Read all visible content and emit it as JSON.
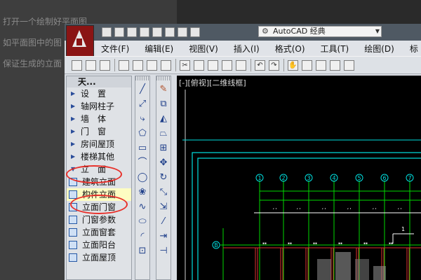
{
  "background": {
    "lines": [
      "打开一个绘制好平面图",
      "如平面图中的图",
      "保证生成的立面"
    ]
  },
  "toolbar": {
    "workspace": "AutoCAD 经典"
  },
  "menubar": {
    "items": [
      "文件(F)",
      "编辑(E)",
      "视图(V)",
      "插入(I)",
      "格式(O)",
      "工具(T)",
      "绘图(D)",
      "标"
    ]
  },
  "palette": {
    "title": "天...",
    "items": [
      {
        "label": "设　置"
      },
      {
        "label": "轴网柱子"
      },
      {
        "label": "墙　体"
      },
      {
        "label": "门　窗"
      },
      {
        "label": "房间屋顶"
      },
      {
        "label": "楼梯其他"
      },
      {
        "label": "立　面"
      }
    ],
    "subitems": [
      {
        "label": "建筑立面",
        "highlighted": false
      },
      {
        "label": "构件立面",
        "highlighted": true
      },
      {
        "label": "立面门窗",
        "highlighted": false
      },
      {
        "label": "门窗参数",
        "highlighted": false
      },
      {
        "label": "立面窗套",
        "highlighted": false
      },
      {
        "label": "立面阳台",
        "highlighted": false
      },
      {
        "label": "立面屋顶",
        "highlighted": false
      }
    ]
  },
  "canvas": {
    "viewport_label": "[-][俯视][二维线框]",
    "axis_labels": [
      "1",
      "2",
      "3",
      "4",
      "5",
      "6",
      "7"
    ],
    "row_label": "B",
    "annotation": "1"
  },
  "colors": {
    "canvas_bg": "#000000",
    "cyan_frame": "#00e0e0",
    "axis_green": "#00d800",
    "wall_red": "#e03030",
    "highlight_ellipse": "#e8312b"
  }
}
